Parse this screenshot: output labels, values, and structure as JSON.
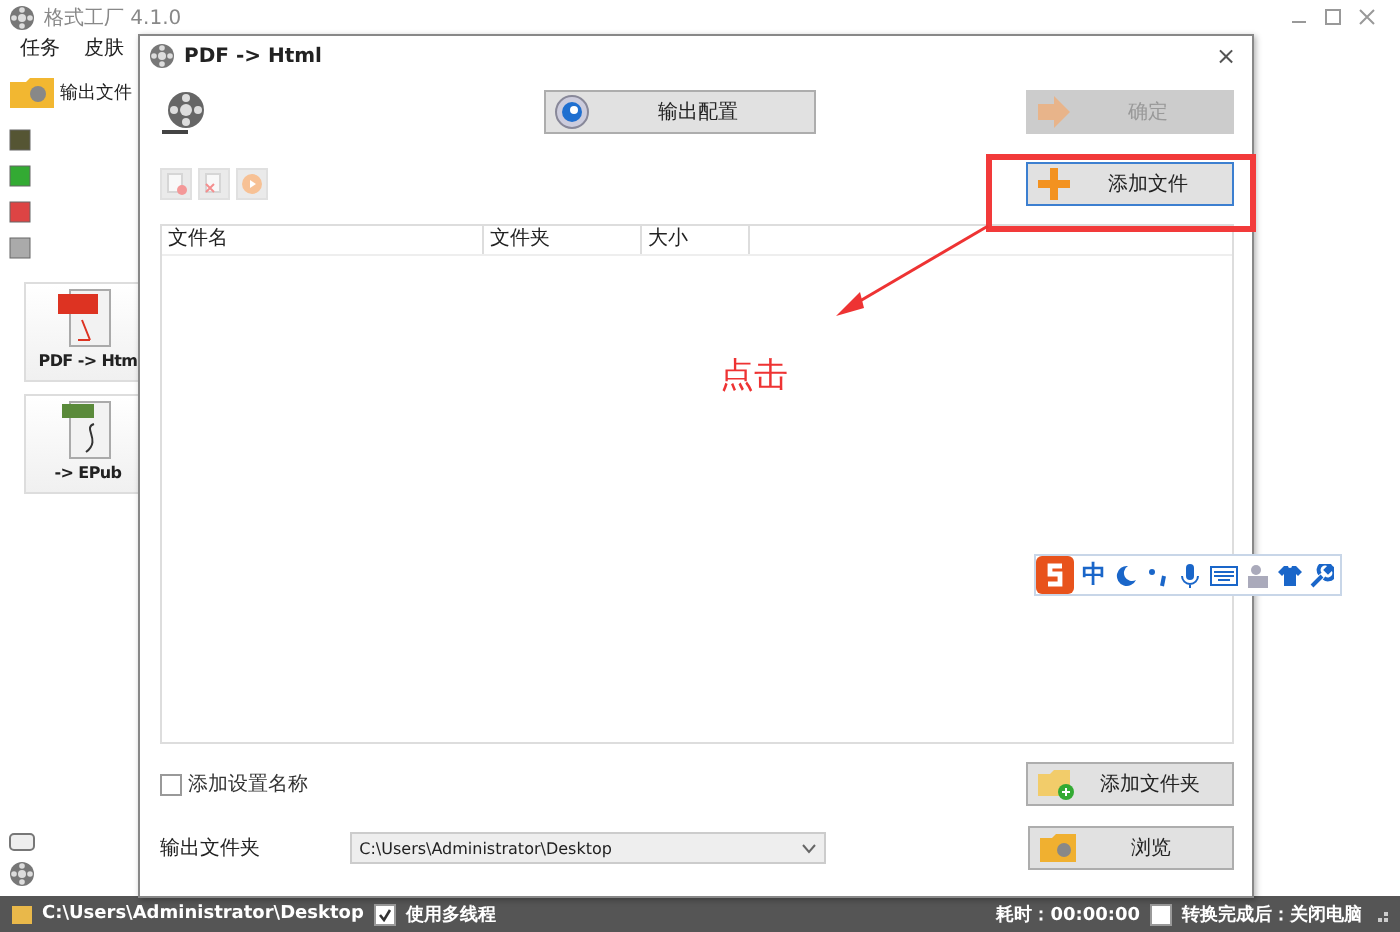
{
  "app_window": {
    "title": "格式工厂 4.1.0",
    "menu": [
      "任务",
      "皮肤"
    ],
    "toolbar_label": "输出文件",
    "tiles": [
      {
        "label": "PDF -> Htm",
        "kind": "pdf"
      },
      {
        "label": "-> EPub",
        "kind": "epub"
      }
    ]
  },
  "dialog": {
    "title": "PDF -> Html",
    "close": "×",
    "config_button": "输出配置",
    "ok_button": {
      "label": "确定",
      "disabled": true
    },
    "tool_buttons": [
      {
        "kind": "remove",
        "disabled": true
      },
      {
        "kind": "clear",
        "disabled": true
      },
      {
        "kind": "play",
        "disabled": true
      }
    ],
    "add_file_button": {
      "label": "添加文件",
      "focused": true
    },
    "file_table": {
      "columns": [
        "文件名",
        "文件夹",
        "大小"
      ]
    },
    "add_setting_name": {
      "label": "添加设置名称",
      "checked": false
    },
    "add_folder_button": "添加文件夹",
    "output_folder": {
      "label": "输出文件夹",
      "value": "C:\\Users\\Administrator\\Desktop"
    },
    "browse_button": "浏览"
  },
  "ime_toolbar": {
    "mode": "中"
  },
  "annotation": {
    "text": "点击"
  },
  "status_bar": {
    "path": "C:\\Users\\Administrator\\Desktop",
    "multithread": {
      "label": "使用多线程",
      "checked": true
    },
    "elapsed": "耗时：00:00:00",
    "shutdown": {
      "label": "转换完成后：关闭电脑",
      "checked": false
    }
  }
}
